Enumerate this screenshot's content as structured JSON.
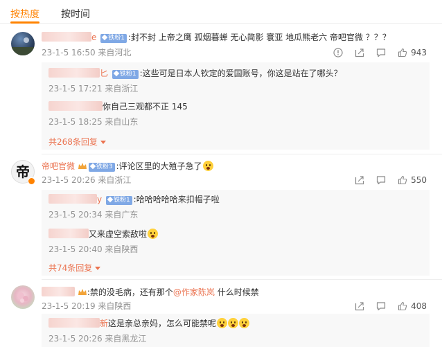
{
  "tabs": [
    {
      "label": "按热度",
      "active": true
    },
    {
      "label": "按时间",
      "active": false
    }
  ],
  "colors": {
    "accent": "#ff8200",
    "link": "#eb7350",
    "meta": "#939393"
  },
  "comments": [
    {
      "name_visible": "e",
      "badge": "铁粉1",
      "text": ":封不封 上帝之鹰 孤烟暮蝉 无心简影 寰亚 地瓜熊老六 帝吧官微 ？？？",
      "meta": "23-1-5 16:50 来自河北",
      "likes": "943",
      "replies": [
        {
          "name_visible": "匕",
          "badge": "铁粉1",
          "text": ":这些可是日本人钦定的爱国账号，你这是站在了哪头？",
          "meta": "23-1-5 17:21 来自浙江"
        },
        {
          "name_visible": "",
          "badge": "",
          "text": "你自己三观都不正 145",
          "meta": "23-1-5 18:25 来自山东"
        }
      ],
      "more_label": "共268条回复"
    },
    {
      "name_visible": "帝吧官微",
      "avatar_char": "帝",
      "badge": "铁粉3",
      "text": ":评论区里的大殖子急了",
      "meta": "23-1-5 20:26 来自浙江",
      "likes": "550",
      "replies": [
        {
          "name_visible": "y",
          "badge": "铁粉1",
          "text": ":哈哈哈哈哈来扣帽子啦",
          "meta": "23-1-5 20:34 来自广东"
        },
        {
          "name_visible": "",
          "badge": "",
          "text": "又来虚空索敌啦",
          "meta": "23-1-5 20:40 来自陕西"
        }
      ],
      "more_label": "共74条回复"
    },
    {
      "name_visible": "",
      "badge": "",
      "text_before": ":禁的没毛病，还有那个",
      "mention": "@作家陈岚",
      "text_after": " 什么时候禁",
      "meta": "23-1-5 20:19 来自陕西",
      "likes": "408",
      "replies": [
        {
          "name_visible": "新",
          "badge": "",
          "text": "这是亲总亲妈，怎么可能禁呢",
          "meta": "23-1-5 20:26 来自黑龙江"
        }
      ]
    }
  ]
}
